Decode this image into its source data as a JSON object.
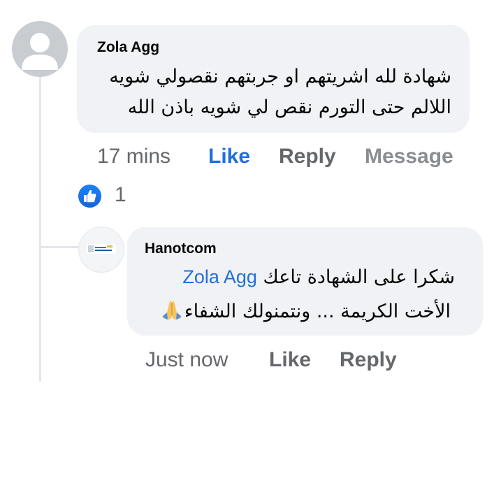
{
  "comment": {
    "author": "Zola Agg",
    "lines": [
      "شهادة لله اشريتهم او جربتهم نقصولي شويه",
      "اللالم حتى التورم نقص لي شويه باذن الله"
    ],
    "timestamp": "17 mins",
    "like_label": "Like",
    "reply_label": "Reply",
    "message_label": "Message",
    "reactions": {
      "icon": "thumbs-up-icon",
      "count": "1",
      "color": "#1877f2"
    }
  },
  "reply": {
    "author": "Hanotcom",
    "line1_text": "شكرا على الشهادة تاعك",
    "mention": "Zola Agg",
    "line2_text": "الأخت الكريمة ... ونتمنولك الشفاء",
    "emoji": "folded-hands-icon",
    "timestamp": "Just now",
    "like_label": "Like",
    "reply_label": "Reply"
  },
  "colors": {
    "bubble": "#f0f2f5",
    "link": "#216fdb",
    "muted": "#65676b"
  }
}
